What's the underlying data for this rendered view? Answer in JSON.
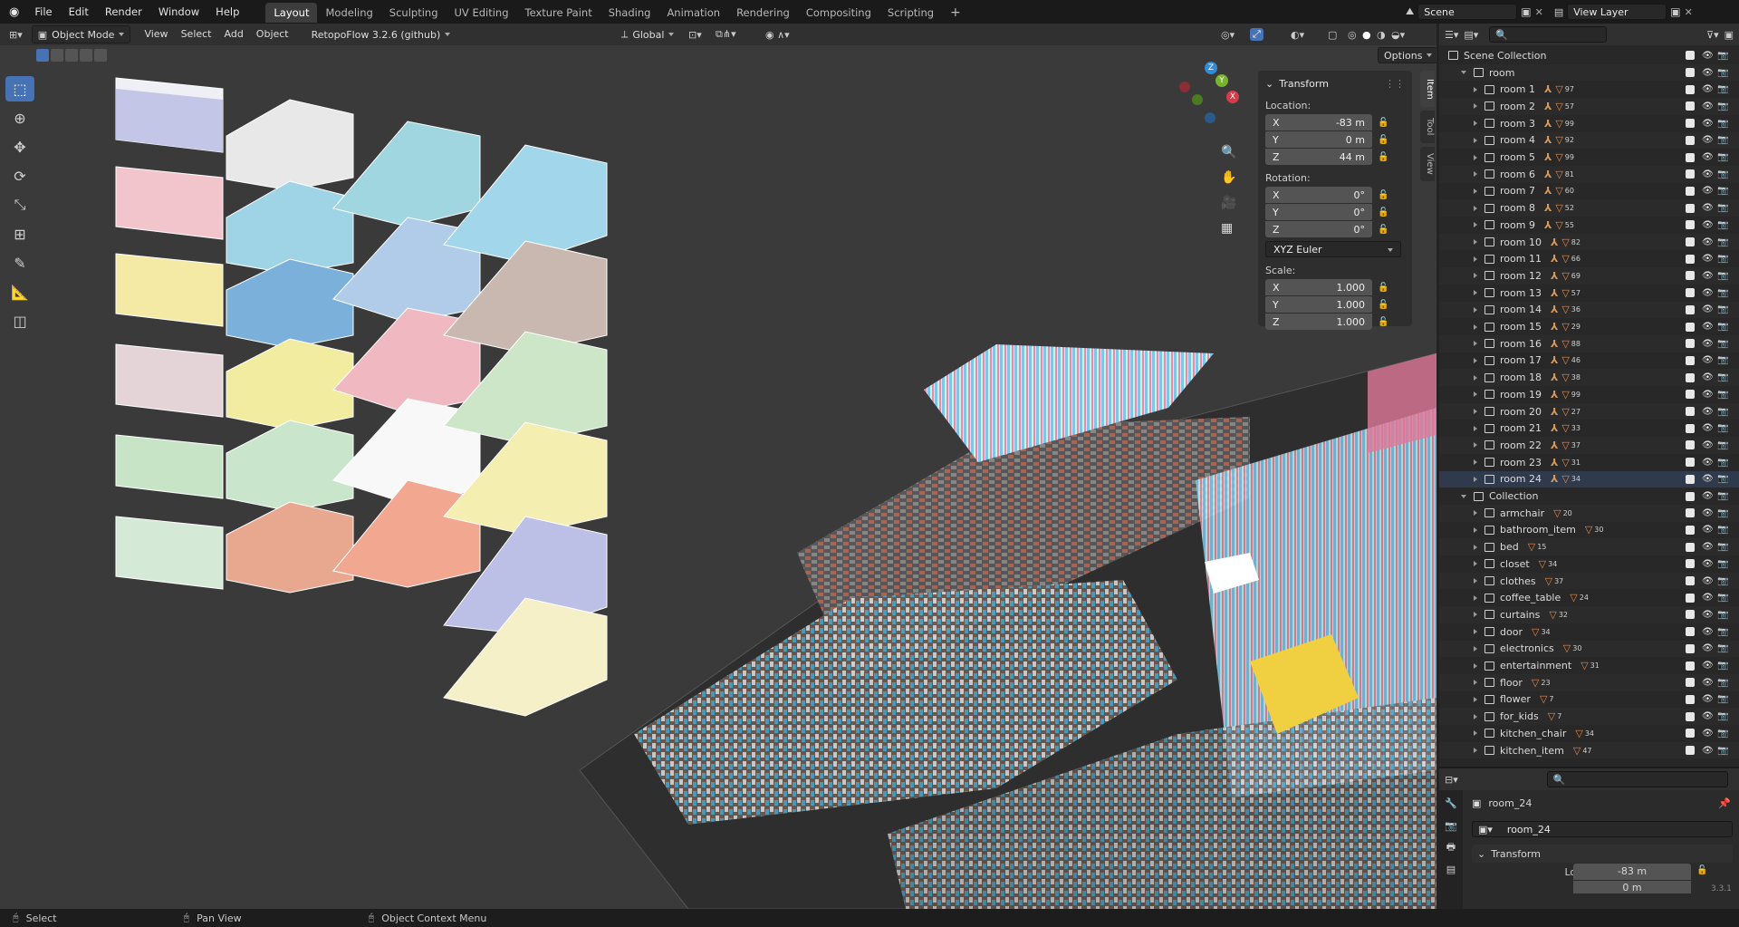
{
  "menu": {
    "items": [
      "File",
      "Edit",
      "Render",
      "Window",
      "Help"
    ]
  },
  "workspaces": {
    "tabs": [
      "Layout",
      "Modeling",
      "Sculpting",
      "UV Editing",
      "Texture Paint",
      "Shading",
      "Animation",
      "Rendering",
      "Compositing",
      "Scripting"
    ],
    "active": "Layout",
    "add": "+"
  },
  "scene": {
    "name": "Scene"
  },
  "view_layer": {
    "name": "View Layer"
  },
  "viewport_header": {
    "mode": "Object Mode",
    "menus": [
      "View",
      "Select",
      "Add",
      "Object"
    ],
    "addon": "RetopoFlow 3.2.6 (github)",
    "orientation": "Global",
    "options": "Options"
  },
  "transform_panel": {
    "title": "Transform",
    "location_label": "Location:",
    "location": [
      {
        "axis": "X",
        "value": "-83 m"
      },
      {
        "axis": "Y",
        "value": "0 m"
      },
      {
        "axis": "Z",
        "value": "44 m"
      }
    ],
    "rotation_label": "Rotation:",
    "rotation": [
      {
        "axis": "X",
        "value": "0°"
      },
      {
        "axis": "Y",
        "value": "0°"
      },
      {
        "axis": "Z",
        "value": "0°"
      }
    ],
    "rotation_mode": "XYZ Euler",
    "scale_label": "Scale:",
    "scale": [
      {
        "axis": "X",
        "value": "1.000"
      },
      {
        "axis": "Y",
        "value": "1.000"
      },
      {
        "axis": "Z",
        "value": "1.000"
      }
    ]
  },
  "side_tabs": [
    "Item",
    "Tool",
    "View"
  ],
  "gizmo": {
    "x": "X",
    "y": "Y",
    "z": "Z"
  },
  "outliner": {
    "root": "Scene Collection",
    "room_collection": "room",
    "rooms": [
      {
        "name": "room 1",
        "count": "97"
      },
      {
        "name": "room 2",
        "count": "57"
      },
      {
        "name": "room 3",
        "count": "99"
      },
      {
        "name": "room 4",
        "count": "92"
      },
      {
        "name": "room 5",
        "count": "99"
      },
      {
        "name": "room 6",
        "count": "81"
      },
      {
        "name": "room 7",
        "count": "60"
      },
      {
        "name": "room 8",
        "count": "52"
      },
      {
        "name": "room 9",
        "count": "55"
      },
      {
        "name": "room 10",
        "count": "82"
      },
      {
        "name": "room 11",
        "count": "66"
      },
      {
        "name": "room 12",
        "count": "69"
      },
      {
        "name": "room 13",
        "count": "57"
      },
      {
        "name": "room 14",
        "count": "36"
      },
      {
        "name": "room 15",
        "count": "29"
      },
      {
        "name": "room 16",
        "count": "88"
      },
      {
        "name": "room 17",
        "count": "46"
      },
      {
        "name": "room 18",
        "count": "38"
      },
      {
        "name": "room 19",
        "count": "99"
      },
      {
        "name": "room 20",
        "count": "27"
      },
      {
        "name": "room 21",
        "count": "33"
      },
      {
        "name": "room 22",
        "count": "37"
      },
      {
        "name": "room 23",
        "count": "31"
      },
      {
        "name": "room 24",
        "count": "34"
      }
    ],
    "asset_collection": "Collection",
    "assets": [
      {
        "name": "armchair",
        "count": "20"
      },
      {
        "name": "bathroom_item",
        "count": "30"
      },
      {
        "name": "bed",
        "count": "15"
      },
      {
        "name": "closet",
        "count": "34"
      },
      {
        "name": "clothes",
        "count": "37"
      },
      {
        "name": "coffee_table",
        "count": "24"
      },
      {
        "name": "curtains",
        "count": "32"
      },
      {
        "name": "door",
        "count": "34"
      },
      {
        "name": "electronics",
        "count": "30"
      },
      {
        "name": "entertainment",
        "count": "31"
      },
      {
        "name": "floor",
        "count": "23"
      },
      {
        "name": "flower",
        "count": "7"
      },
      {
        "name": "for_kids",
        "count": "7"
      },
      {
        "name": "kitchen_chair",
        "count": "34"
      },
      {
        "name": "kitchen_item",
        "count": "47"
      }
    ]
  },
  "properties": {
    "object_name": "room_24",
    "data_name": "room_24",
    "section": "Transform",
    "location_x_label": "Location X",
    "location_x": "-83 m",
    "location_y_label": "Y",
    "location_y": "0 m",
    "version": "3.3.1"
  },
  "statusbar": {
    "select": "Select",
    "pan": "Pan View",
    "context": "Object Context Menu"
  }
}
